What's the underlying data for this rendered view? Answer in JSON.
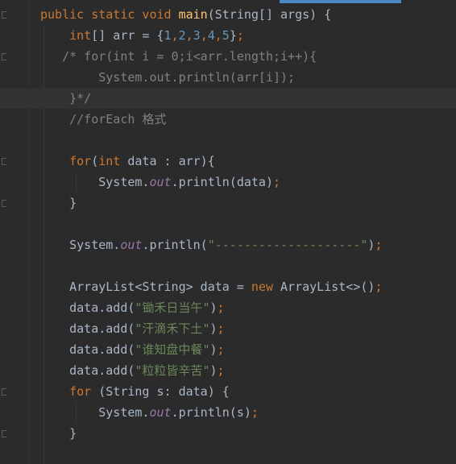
{
  "editor": {
    "theme": "darcula",
    "colors": {
      "background": "#2b2b2b",
      "keyword": "#cc7832",
      "method_decl": "#ffc66d",
      "number": "#6897bb",
      "string": "#6a8759",
      "comment": "#808080",
      "static_field": "#9876aa",
      "default_text": "#a9b7c6",
      "scroll_indicator": "#4a88c7"
    },
    "gutter_icons": [
      "fold-icon",
      "lightbulb-icon"
    ],
    "lines": [
      [
        {
          "t": "public static void ",
          "c": "kw"
        },
        {
          "t": "main",
          "c": "fn"
        },
        {
          "t": "(String[] args) {",
          "c": "plain"
        }
      ],
      [
        {
          "t": "    ",
          "c": "plain"
        },
        {
          "t": "int",
          "c": "kw"
        },
        {
          "t": "[] arr = {",
          "c": "plain"
        },
        {
          "t": "1",
          "c": "num"
        },
        {
          "t": ",",
          "c": "kw"
        },
        {
          "t": "2",
          "c": "num"
        },
        {
          "t": ",",
          "c": "kw"
        },
        {
          "t": "3",
          "c": "num"
        },
        {
          "t": ",",
          "c": "kw"
        },
        {
          "t": "4",
          "c": "num"
        },
        {
          "t": ",",
          "c": "kw"
        },
        {
          "t": "5",
          "c": "num"
        },
        {
          "t": "}",
          "c": "plain"
        },
        {
          "t": ";",
          "c": "kw"
        }
      ],
      [
        {
          "t": "   /* for(int i = 0;i<arr.length;i++){",
          "c": "cmt"
        }
      ],
      [
        {
          "t": "        System.out.println(arr[i]);",
          "c": "cmt"
        }
      ],
      [
        {
          "t": "    }*/",
          "c": "cmt"
        }
      ],
      [
        {
          "t": "    //forEach 格式",
          "c": "cmt"
        }
      ],
      [
        {
          "t": "",
          "c": "plain"
        }
      ],
      [
        {
          "t": "    ",
          "c": "plain"
        },
        {
          "t": "for",
          "c": "kw"
        },
        {
          "t": "(",
          "c": "plain"
        },
        {
          "t": "int",
          "c": "kw"
        },
        {
          "t": " data : arr){",
          "c": "plain"
        }
      ],
      [
        {
          "t": "        System.",
          "c": "plain"
        },
        {
          "t": "out",
          "c": "fld"
        },
        {
          "t": ".println(data)",
          "c": "plain"
        },
        {
          "t": ";",
          "c": "kw"
        }
      ],
      [
        {
          "t": "    }",
          "c": "plain"
        }
      ],
      [
        {
          "t": "",
          "c": "plain"
        }
      ],
      [
        {
          "t": "    System.",
          "c": "plain"
        },
        {
          "t": "out",
          "c": "fld"
        },
        {
          "t": ".println(",
          "c": "plain"
        },
        {
          "t": "\"--------------------\"",
          "c": "str"
        },
        {
          "t": ")",
          "c": "plain"
        },
        {
          "t": ";",
          "c": "kw"
        }
      ],
      [
        {
          "t": "",
          "c": "plain"
        }
      ],
      [
        {
          "t": "    ArrayList<String> data = ",
          "c": "plain"
        },
        {
          "t": "new ",
          "c": "kw"
        },
        {
          "t": "ArrayList<>()",
          "c": "plain"
        },
        {
          "t": ";",
          "c": "kw"
        }
      ],
      [
        {
          "t": "    data.add(",
          "c": "plain"
        },
        {
          "t": "\"锄禾日当午\"",
          "c": "str"
        },
        {
          "t": ")",
          "c": "plain"
        },
        {
          "t": ";",
          "c": "kw"
        }
      ],
      [
        {
          "t": "    data.add(",
          "c": "plain"
        },
        {
          "t": "\"汗滴禾下土\"",
          "c": "str"
        },
        {
          "t": ")",
          "c": "plain"
        },
        {
          "t": ";",
          "c": "kw"
        }
      ],
      [
        {
          "t": "    data.add(",
          "c": "plain"
        },
        {
          "t": "\"谁知盘中餐\"",
          "c": "str"
        },
        {
          "t": ")",
          "c": "plain"
        },
        {
          "t": ";",
          "c": "kw"
        }
      ],
      [
        {
          "t": "    data.add(",
          "c": "plain"
        },
        {
          "t": "\"粒粒皆辛苦\"",
          "c": "str"
        },
        {
          "t": ")",
          "c": "plain"
        },
        {
          "t": ";",
          "c": "kw"
        }
      ],
      [
        {
          "t": "    ",
          "c": "plain"
        },
        {
          "t": "for ",
          "c": "kw"
        },
        {
          "t": "(String s: data) {",
          "c": "plain"
        }
      ],
      [
        {
          "t": "        System.",
          "c": "plain"
        },
        {
          "t": "out",
          "c": "fld"
        },
        {
          "t": ".println(s)",
          "c": "plain"
        },
        {
          "t": ";",
          "c": "kw"
        }
      ],
      [
        {
          "t": "    }",
          "c": "plain"
        }
      ]
    ]
  }
}
